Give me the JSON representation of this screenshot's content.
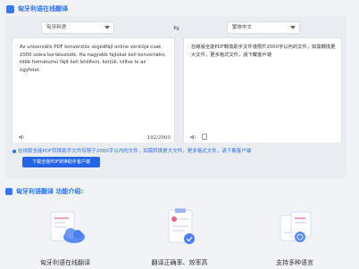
{
  "header": {
    "title": "匈牙利语在线翻译"
  },
  "translator": {
    "source_lang": "匈牙利语",
    "target_lang": "繁体中文",
    "source_text": "Az univerzális PDF konverziós segédfájl online verziója csak 2000 szóra korlátozódik. Ha nagyobb fájlokat kell konvertálni, több formátumú fájlt kell letölteni, kérjük, töltse le az ügyfelet.",
    "target_text": "在線版全能PDF轉換助手文件僅限於2000字以內的文件，如需轉換更大文件，更多格式文件，請下載客戶端",
    "char_count": "192/2000"
  },
  "notice": {
    "message": "在线版全能PDF转换助手文件仅限于2000字以内的文件，如需转换更大文件，更多格式文件，请下载客户端",
    "download_label": "下载全能PDF转换助手客户端"
  },
  "features": {
    "title": "匈牙利语翻译 功能介绍:",
    "items": [
      {
        "label": "匈牙利语在线翻译"
      },
      {
        "label": "翻译正确率、效率高"
      },
      {
        "label": "支持多种语言"
      }
    ]
  },
  "colors": {
    "accent": "#2d6ff2",
    "button": "#2565e5"
  }
}
